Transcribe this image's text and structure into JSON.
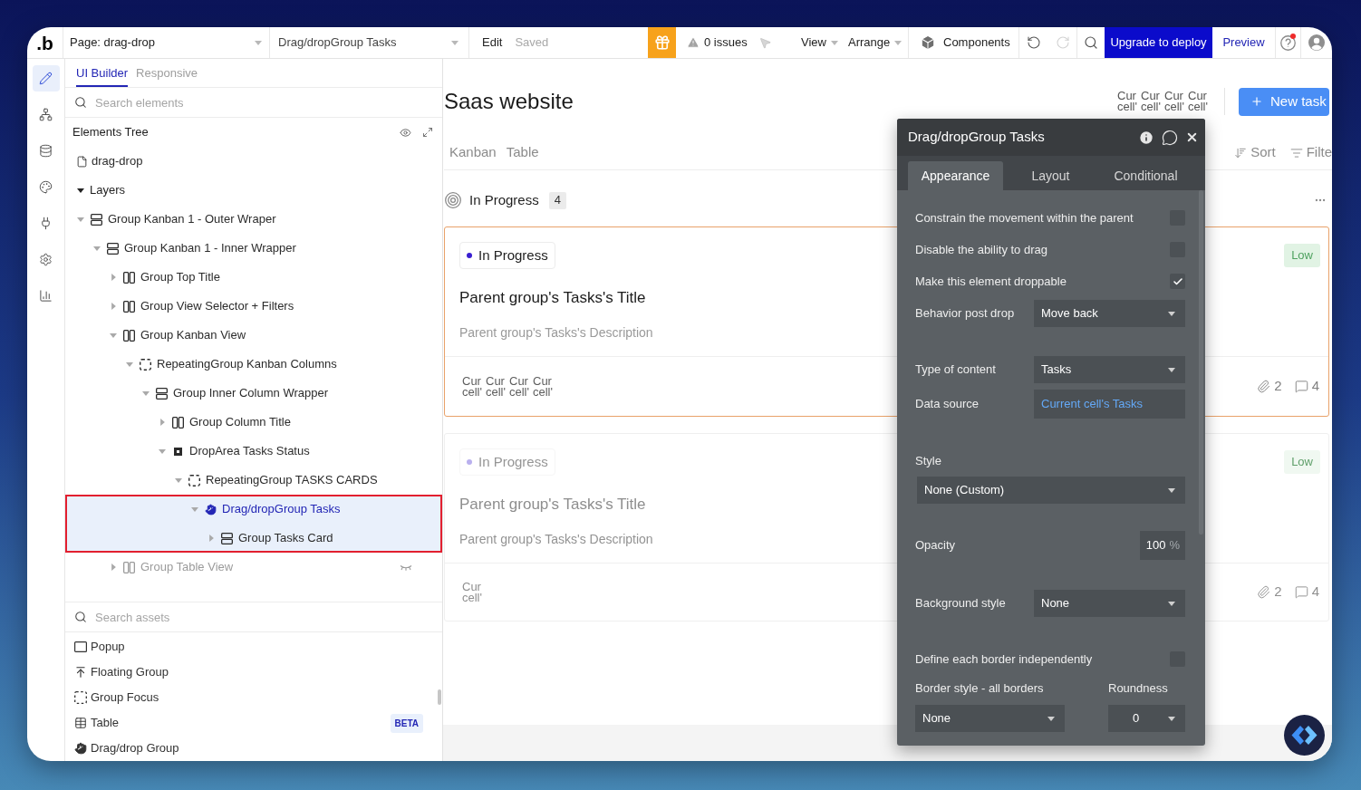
{
  "window": {
    "logo": ".b"
  },
  "toolbar": {
    "page_select": "Page: drag-drop",
    "element_select": "Drag/dropGroup Tasks",
    "edit": "Edit",
    "save_status": "Saved",
    "issues": "0 issues",
    "menus": [
      {
        "label": "View"
      },
      {
        "label": "Arrange"
      }
    ],
    "components": "Components",
    "history": [
      {
        "disabled": false
      },
      {
        "disabled": true
      }
    ],
    "upgrade": "Upgrade to deploy",
    "preview": "Preview",
    "help_notification": true
  },
  "sidebar": {
    "items": [
      {
        "selected": true
      },
      {
        "selected": false
      },
      {
        "selected": false
      },
      {
        "selected": false
      },
      {
        "selected": false
      },
      {
        "selected": false
      },
      {
        "selected": false
      }
    ]
  },
  "elements_panel": {
    "tabs": [
      {
        "label": "UI Builder",
        "selected": true
      },
      {
        "label": "Responsive",
        "selected": false
      }
    ],
    "search": {
      "placeholder": "Search elements"
    },
    "tree_title": "Elements Tree",
    "page": {
      "label": "drag-drop"
    },
    "layers": {
      "label": "Layers",
      "expanded": true,
      "children": [
        {
          "label": "Group Kanban 1 - Outer Wraper",
          "kind": "column-group",
          "expanded": true,
          "selected": false,
          "hidden": false,
          "children": [
            {
              "label": "Group Kanban 1 - Inner Wrapper",
              "kind": "column-group",
              "expanded": true,
              "selected": false,
              "hidden": false,
              "children": [
                {
                  "label": "Group Top Title",
                  "kind": "row-group",
                  "expanded": false,
                  "selected": false,
                  "hidden": false
                },
                {
                  "label": "Group View Selector + Filters",
                  "kind": "row-group",
                  "expanded": false,
                  "selected": false,
                  "hidden": false
                },
                {
                  "label": "Group Kanban View",
                  "kind": "row-group",
                  "expanded": true,
                  "selected": false,
                  "hidden": false,
                  "children": [
                    {
                      "label": "RepeatingGroup Kanban Columns",
                      "kind": "repeating-group",
                      "expanded": true,
                      "selected": false,
                      "hidden": false,
                      "children": [
                        {
                          "label": "Group Inner Column Wrapper",
                          "kind": "column-group",
                          "expanded": true,
                          "selected": false,
                          "hidden": false,
                          "children": [
                            {
                              "label": "Group Column Title",
                              "kind": "row-group",
                              "expanded": false,
                              "selected": false,
                              "hidden": false
                            },
                            {
                              "label": "DropArea Tasks Status",
                              "kind": "drop-area",
                              "expanded": true,
                              "selected": false,
                              "hidden": false,
                              "children": [
                                {
                                  "label": "RepeatingGroup TASKS CARDS",
                                  "kind": "repeating-group",
                                  "expanded": true,
                                  "selected": false,
                                  "hidden": false,
                                  "children": [
                                    {
                                      "label": "Drag/dropGroup Tasks",
                                      "kind": "drag-group",
                                      "expanded": true,
                                      "selected": true,
                                      "hidden": false,
                                      "children": [
                                        {
                                          "label": "Group Tasks Card",
                                          "kind": "column-group",
                                          "expanded": false,
                                          "selected": false,
                                          "hidden": false
                                        }
                                      ]
                                    }
                                  ]
                                }
                              ]
                            }
                          ]
                        }
                      ]
                    }
                  ]
                },
                {
                  "label": "Group Table View",
                  "kind": "row-group",
                  "expanded": false,
                  "selected": false,
                  "hidden": true
                }
              ]
            }
          ]
        }
      ]
    },
    "assets_search": {
      "placeholder": "Search assets"
    },
    "assets": [
      {
        "label": "Popup"
      },
      {
        "label": "Floating Group"
      },
      {
        "label": "Group Focus"
      },
      {
        "label": "Table",
        "badge": "BETA"
      },
      {
        "label": "Drag/drop Group"
      }
    ]
  },
  "canvas": {
    "title": "Saas website",
    "header_names": [
      {
        "line_1": "Cur",
        "line_2": "cell'"
      },
      {
        "line_1": "Cur",
        "line_2": "cell'"
      },
      {
        "line_1": "Cur",
        "line_2": "cell'"
      },
      {
        "line_1": "Cur",
        "line_2": "cell'"
      }
    ],
    "new_task": "New task",
    "view_tabs": [
      "Kanban",
      "Table"
    ],
    "sort": "Sort",
    "filter": "Filte",
    "column": {
      "title": "In Progress",
      "count": "4"
    },
    "cards": [
      {
        "selected": true,
        "faded": false,
        "status": "In Progress",
        "title": "Parent group's Tasks's Title",
        "description": "Parent group's Tasks's Description",
        "names": [
          {
            "line_1": "Cur",
            "line_2": "cell'"
          },
          {
            "line_1": "Cur",
            "line_2": "cell'"
          },
          {
            "line_1": "Cur",
            "line_2": "cell'"
          },
          {
            "line_1": "Cur",
            "line_2": "cell'"
          }
        ],
        "priority": "Low",
        "attachments": "2",
        "comments": "4"
      },
      {
        "selected": false,
        "faded": true,
        "status": "In Progress",
        "title": "Parent group's Tasks's Title",
        "description": "Parent group's Tasks's Description",
        "names": [
          {
            "line_1": "Cur",
            "line_2": "cell'"
          }
        ],
        "priority": "Low",
        "attachments": "2",
        "comments": "4"
      }
    ]
  },
  "property_panel": {
    "title": "Drag/dropGroup Tasks",
    "tabs": [
      {
        "label": "Appearance",
        "selected": true
      },
      {
        "label": "Layout",
        "selected": false
      },
      {
        "label": "Conditional",
        "selected": false
      }
    ],
    "sections": [
      {
        "rows": [
          {
            "kind": "checkbox",
            "label": "Constrain the movement within the parent",
            "checked": false
          },
          {
            "kind": "checkbox",
            "label": "Disable the ability to drag",
            "checked": false
          },
          {
            "kind": "checkbox",
            "label": "Make this element droppable",
            "checked": true
          },
          {
            "kind": "dropdown",
            "label": "Behavior post drop",
            "value": "Move back"
          }
        ]
      },
      {
        "rows": [
          {
            "kind": "dropdown",
            "label": "Type of content",
            "value": "Tasks"
          },
          {
            "kind": "expression",
            "label": "Data source",
            "value": "Current cell's Tasks"
          }
        ]
      },
      {
        "rows": [
          {
            "kind": "wide-dropdown",
            "label": "Style",
            "value": "None (Custom)"
          }
        ]
      },
      {
        "rows": [
          {
            "kind": "number",
            "label": "Opacity",
            "value": "100",
            "unit": "%"
          }
        ]
      },
      {
        "rows": [
          {
            "kind": "dropdown",
            "label": "Background style",
            "value": "None"
          }
        ]
      },
      {
        "rows": [
          {
            "kind": "checkbox",
            "label": "Define each border independently",
            "checked": false
          },
          {
            "kind": "dropdown-pair",
            "fields": [
              {
                "label": "Border style - all borders",
                "value": "None"
              },
              {
                "label": "Roundness",
                "value": "0"
              }
            ]
          }
        ]
      }
    ]
  }
}
